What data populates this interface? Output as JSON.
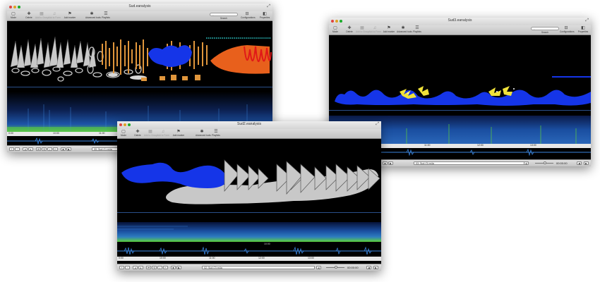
{
  "windows": {
    "left": {
      "title": "Sud.eanalysis",
      "toolbar": {
        "mode": "Mode",
        "delete": "Delete",
        "add_to_group": "Add to Group",
        "add_to_form": "Add to Form",
        "add_marker": "Add marker",
        "advanced_tools": "Advanced tools",
        "playlists": "Playlists",
        "search_label": "Search",
        "configurations": "Configurations",
        "properties": "Properties"
      },
      "ruler_ticks": [
        "0:00",
        "10:00",
        "11:00",
        "12:00",
        "13:00"
      ],
      "track": "00: Sud (1).m4a",
      "time": "00:00:00"
    },
    "middle": {
      "title": "Sud2.eanalysis",
      "toolbar": {
        "mode": "Mode",
        "delete": "Delete",
        "add_to_group": "Add to Group",
        "add_to_form": "Add to Form",
        "add_marker": "Add marker",
        "advanced_tools": "Advanced tools",
        "playlists": "Playlists"
      },
      "spec_tick": "10:00",
      "ruler_ticks": [
        "0:00",
        "10:00",
        "11:00",
        "12:00",
        "13:00"
      ],
      "track": "02: Sud (2).m4a",
      "time": "00:00:00"
    },
    "right": {
      "title": "Sud3.eanalysis",
      "toolbar": {
        "mode": "Mode",
        "delete": "Delete",
        "add_to_group": "Add to Group",
        "add_to_form": "Add to Form",
        "add_marker": "Add marker",
        "advanced_tools": "Advanced tools",
        "playlists": "Playlists",
        "search_label": "Search",
        "configurations": "Configurations",
        "properties": "Properties"
      },
      "ruler_ticks": [
        "0:00",
        "10:00",
        "11:00",
        "12:00",
        "13:00"
      ],
      "track": "03: Sud (3).m4a",
      "time": "00:00:00"
    }
  },
  "colors": {
    "window_bg": "#000000",
    "shape_gray": "#c8c8c8",
    "shape_orange": "#e0963c",
    "shape_blue": "#1535e8",
    "shape_red": "#e01818",
    "shape_yellow": "#f0e23a",
    "spectrum_green": "#5fd23a",
    "waveform_blue": "#3b86e0"
  },
  "icons": [
    "mode-icon",
    "delete-icon",
    "add-to-group-icon",
    "add-to-form-icon",
    "add-marker-icon",
    "advanced-tools-icon",
    "playlists-icon",
    "configurations-icon",
    "properties-icon"
  ]
}
